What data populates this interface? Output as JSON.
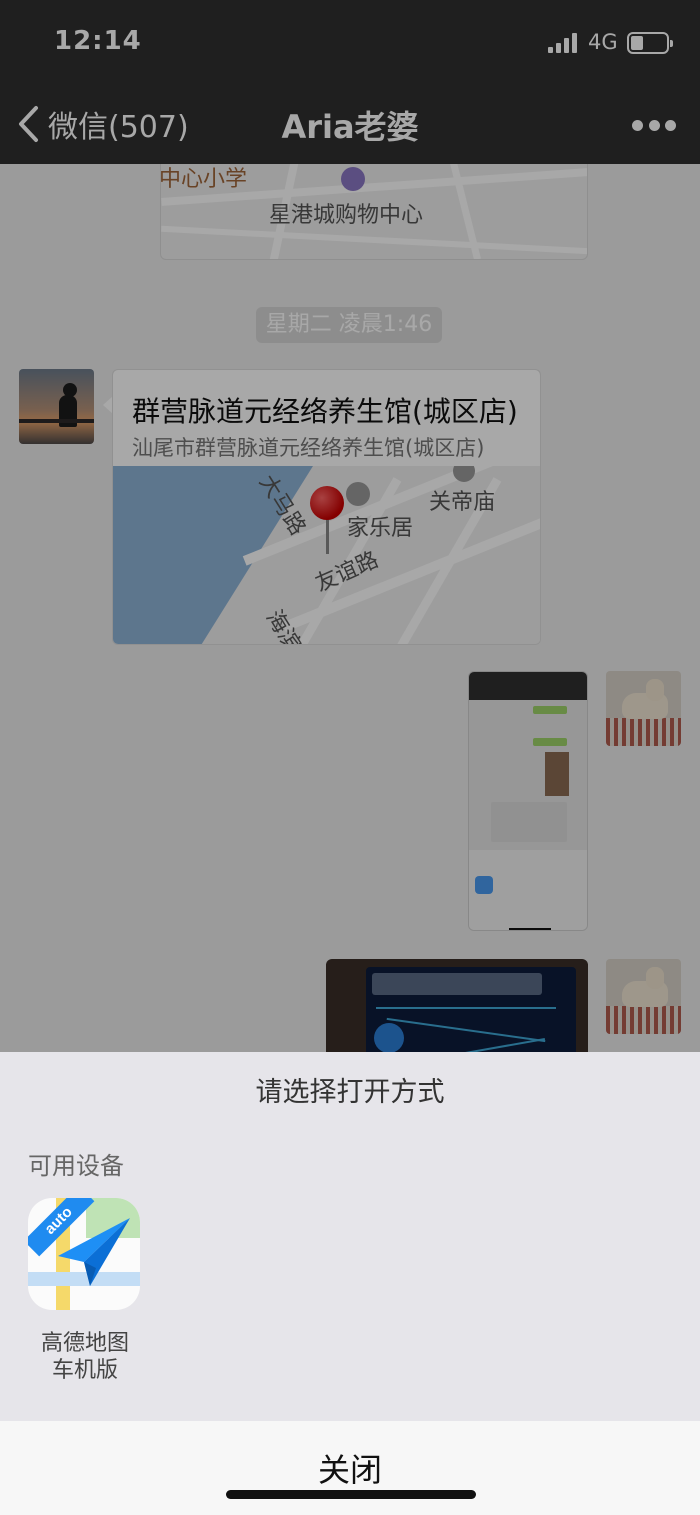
{
  "status_bar": {
    "time": "12:14",
    "network": "4G",
    "battery_level": 0.35
  },
  "nav": {
    "back_label": "微信(507)",
    "title": "Aria老婆"
  },
  "chat": {
    "top_map_labels": [
      "中心小学",
      "星港城购物中心"
    ],
    "timestamp": "星期二 凌晨1:46",
    "location": {
      "title": "群营脉道元经络养生馆(城区店)",
      "subtitle": "汕尾市群营脉道元经络养生馆(城区店)",
      "map_labels": [
        "大马路",
        "家乐居",
        "关帝庙",
        "友谊路",
        "海滨"
      ]
    }
  },
  "sheet": {
    "title": "请选择打开方式",
    "section_label": "可用设备",
    "apps": [
      {
        "name": "高德地图\n车机版",
        "badge": "auto"
      }
    ],
    "close_label": "关闭"
  }
}
